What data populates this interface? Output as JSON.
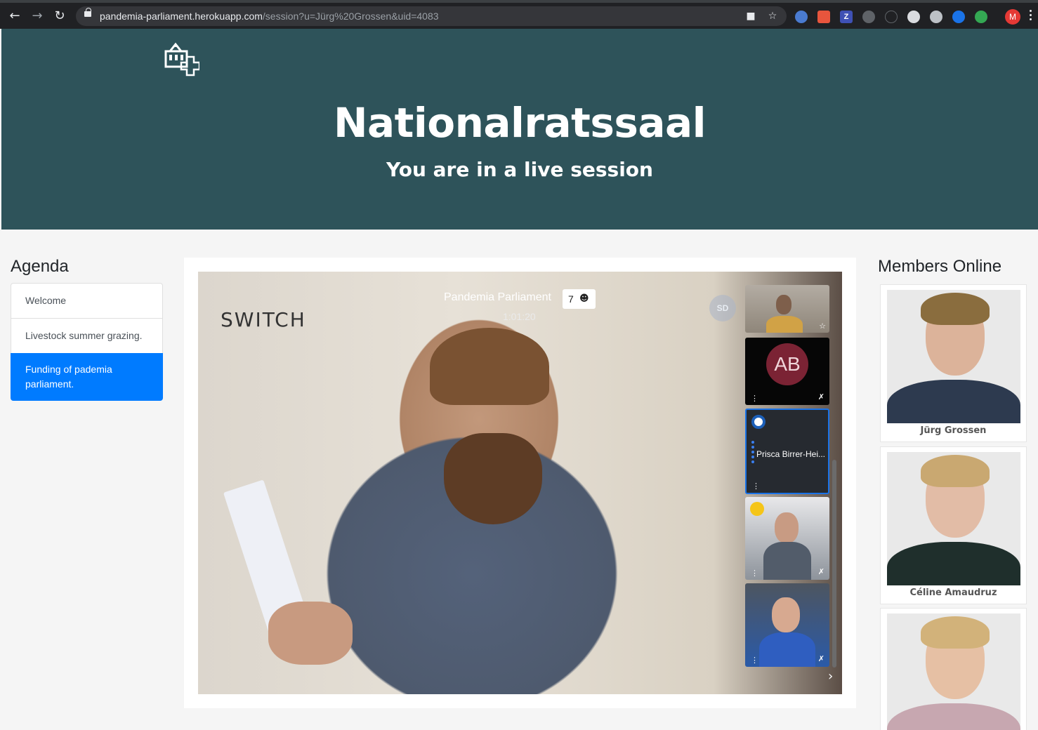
{
  "browser": {
    "url_host": "pandemia-parliament.herokuapp.com",
    "url_path": "/session?u=Jürg%20Grossen&uid=4083",
    "profile_initial": "M",
    "extensions": [
      {
        "icon": "ext-z-icon",
        "label": "Z",
        "color": "#3f51b5"
      }
    ]
  },
  "header": {
    "title": "Nationalratssaal",
    "subtitle": "You are in a live session"
  },
  "agenda": {
    "heading": "Agenda",
    "items": [
      {
        "label": "Welcome",
        "active": false
      },
      {
        "label": "Livestock summer grazing.",
        "active": false
      },
      {
        "label": "Funding of pademia parliament.",
        "active": true
      }
    ]
  },
  "meeting": {
    "brand": "SWITCH",
    "title": "Pandemia Parliament",
    "elapsed": "1:01:20",
    "participant_count": "7",
    "host_avatar": "SD",
    "thumbnails": [
      {
        "type": "video"
      },
      {
        "type": "avatar",
        "initials": "AB"
      },
      {
        "type": "name",
        "name": "Prisca Birrer-Hei..."
      },
      {
        "type": "video"
      },
      {
        "type": "video"
      }
    ]
  },
  "members": {
    "heading": "Members Online",
    "list": [
      {
        "name": "Jürg Grossen"
      },
      {
        "name": "Céline Amaudruz"
      },
      {
        "name": ""
      }
    ]
  },
  "colors": {
    "banner": "#2e535a",
    "active_item": "#007bff",
    "chrome": "#202124"
  }
}
